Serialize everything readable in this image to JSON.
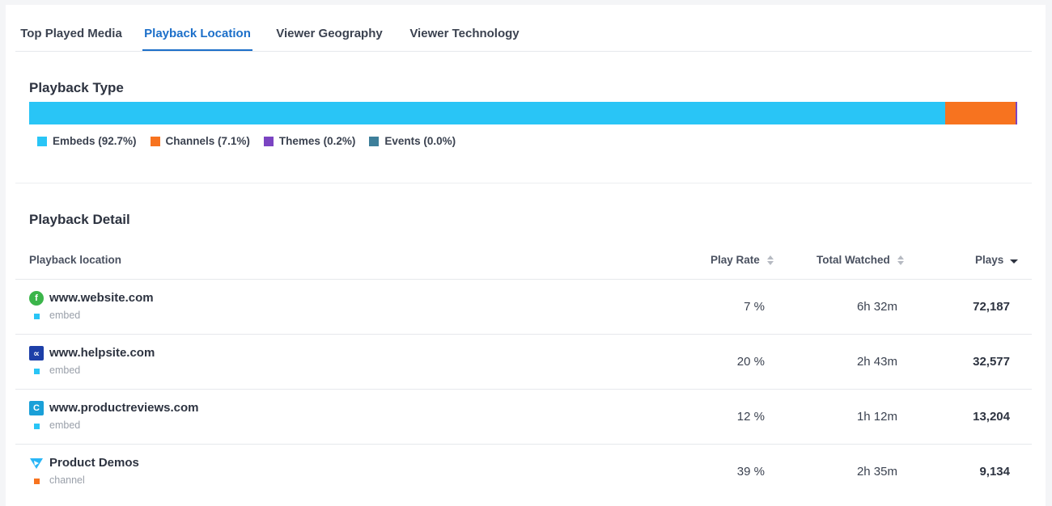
{
  "tabs": [
    {
      "label": "Top Played Media",
      "active": false
    },
    {
      "label": "Playback Location",
      "active": true
    },
    {
      "label": "Viewer Geography",
      "active": false
    },
    {
      "label": "Viewer Technology",
      "active": false
    }
  ],
  "playback_type": {
    "title": "Playback Type",
    "segments": [
      {
        "label": "Embeds (92.7%)",
        "percent": 92.7,
        "color": "#29c5f6"
      },
      {
        "label": "Channels (7.1%)",
        "percent": 7.1,
        "color": "#f7731f"
      },
      {
        "label": "Themes (0.2%)",
        "percent": 0.2,
        "color": "#7b44c2"
      },
      {
        "label": "Events (0.0%)",
        "percent": 0.0,
        "color": "#3d7f9a"
      }
    ]
  },
  "playback_detail": {
    "title": "Playback Detail",
    "columns": {
      "location": "Playback location",
      "play_rate": "Play Rate",
      "total_watched": "Total Watched",
      "plays": "Plays"
    },
    "rows": [
      {
        "name": "www.website.com",
        "type": "embed",
        "type_color": "#29c5f6",
        "icon": "f",
        "icon_name": "website-favicon-icon",
        "icon_bg": "#3bb54a",
        "icon_round": true,
        "play_rate": "7 %",
        "total_watched": "6h 32m",
        "plays": "72,187"
      },
      {
        "name": "www.helpsite.com",
        "type": "embed",
        "type_color": "#29c5f6",
        "icon": "∝",
        "icon_name": "helpsite-favicon-icon",
        "icon_bg": "#1d3fa8",
        "icon_round": false,
        "play_rate": "20 %",
        "total_watched": "2h 43m",
        "plays": "32,577"
      },
      {
        "name": "www.productreviews.com",
        "type": "embed",
        "type_color": "#29c5f6",
        "icon": "C",
        "icon_name": "productreviews-favicon-icon",
        "icon_bg": "#1aa0d8",
        "icon_round": false,
        "play_rate": "12 %",
        "total_watched": "1h 12m",
        "plays": "13,204"
      },
      {
        "name": "Product Demos",
        "type": "channel",
        "type_color": "#f7731f",
        "icon": "",
        "icon_name": "channel-play-icon",
        "icon_bg": "",
        "icon_round": false,
        "play_rate": "39 %",
        "total_watched": "2h 35m",
        "plays": "9,134"
      }
    ]
  }
}
